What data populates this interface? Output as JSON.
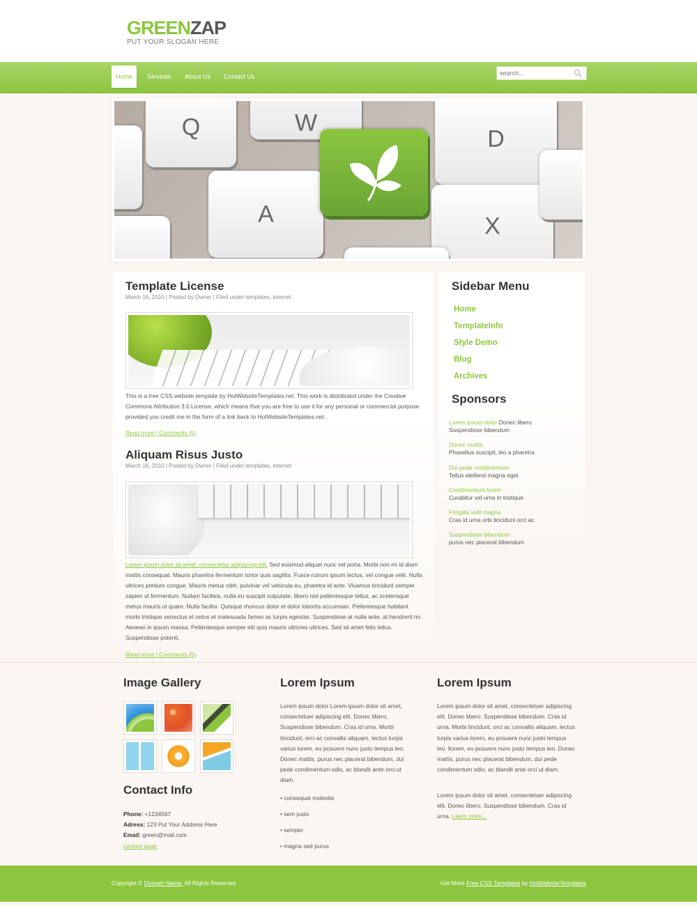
{
  "header": {
    "logo_green": "GREEN",
    "logo_gray": "ZAP",
    "slogan": "PUT YOUR SLOGAN HERE"
  },
  "nav": {
    "items": [
      "Home",
      "Services",
      "About Us",
      "Contact Us"
    ],
    "active": "Home"
  },
  "search": {
    "placeholder": "search..."
  },
  "hero": {
    "keys": [
      "Q",
      "W",
      "D",
      "A",
      "X"
    ]
  },
  "posts": [
    {
      "title": "Template License",
      "meta": "March 16, 2010 | Posted by Owner | Filed under templates, internet",
      "body": "This is a free CSS website template by HotWebsiteTemplates.net. This work is distributed under the Creative Commons Attribution 3.0 License, which means that you are free to use it for any personal or commercial purpose provided you credit me in the form of a link back to HotWebsiteTemplates.net.",
      "read_more": "Read more | Comments (5)"
    },
    {
      "title": "Aliquam Risus Justo",
      "meta": "March 16, 2010 | Posted by Owner | Filed under templates, internet",
      "link_text": "Lorem ipsum dolor sit amet, consectetur adipiscing elit.",
      "body": " Sed euismod aliquet nunc vel porta. Morbi non mi id diam mattis consequat. Mauris pharetra fermentum tortor quis sagittis. Fusce rutrum ipsum lectus, vel congue velit. Nulla ultrices pretium congue. Mauris metus nibh, pulvinar vel vehicula eu, pharetra id ante. Vivamus tincidunt semper sapien ut fermentum. Nullam facilisis, nulla eu suscipit vulputate, libero nisl pellentesque tellus, ac scelerisque metus mauris ut quam. Nulla facilisi. Quisque rhoncus dolor et dolor lobortis accumsan. Pellentesque habitant morbi tristique senectus et netus et malesuada fames ac turpis egestas. Suspendisse at nulla ante, at hendrerit mi. Aenean in ipsum massa. Pellentesque semper elit quis mauris ultricies ultrices. Sed sit amet felis tellus. Suspendisse potenti.",
      "read_more": "Read more | Comments (5)"
    }
  ],
  "sidebar": {
    "menu_title": "Sidebar Menu",
    "menu": [
      "Home",
      "TemplateInfo",
      "Style Demo",
      "Blog",
      "Archives"
    ],
    "sponsors_title": "Sponsors",
    "sponsors": [
      {
        "link": "Lorem ipsum dolor",
        "after": " Donec libero.",
        "line2": "Suspendisse bibendum"
      },
      {
        "link": "Donec mattis",
        "after": "",
        "line2": "Phasellus suscipit, leo a pharetra"
      },
      {
        "link": "Dui pede condimentum",
        "after": "",
        "line2": "Tellus eleifend magna eget"
      },
      {
        "link": "Condimentum lorem",
        "after": "",
        "line2": "Curabitur vel urna in tristique"
      },
      {
        "link": "Fringilla velit magna",
        "after": "",
        "line2": "Cras id urna orbi tincidunt orci ac"
      },
      {
        "link": "Suspendisse bibendum",
        "after": "",
        "line2": "purus nec placerat bibendum"
      }
    ]
  },
  "footer": {
    "gallery_title": "Image Gallery",
    "contact_title": "Contact Info",
    "contact": {
      "phone_label": "Phone:",
      "phone": " +1234567",
      "address_label": "Adress:",
      "address": " 123 Put Your Address Here",
      "email_label": "Email:",
      "email": " green@mail.com",
      "link": "contact page"
    },
    "col2": {
      "title": "Lorem Ipsum",
      "text": "Lorem ipsum dolor Lorem ipsum dolor sit amet, consectetuer adipiscing elit. Donec libero. Suspendisse bibendum. Cras id urna. Morbi tincidunt, orci ac convallis aliquam, lectus turpis varius lorem, eu posuere nunc justo tempus leo. Donec mattis, purus nec placerat bibendum, dui pede condimentum odio, ac blandit ante orci ut diam.",
      "bullets": [
        "• consequat molestie",
        "• sem justo",
        "• semper",
        "• magna sed purus"
      ]
    },
    "col3": {
      "title": "Lorem Ipsum",
      "text1": "Lorem ipsum dolor sit amet, consectetuer adipiscing elit. Donec libero. Suspendisse bibendum. Cras id urna. Morbi tincidunt, orci ac convallis aliquam, lectus turpis varius lorem, eu posuere nunc justo tempus leo. llorem, eu posuere nunc justo tempus leo. Donec mattis, purus nec placerat bibendum, dui pede condimentum odio, ac blandit ante orci ut diam.",
      "text2": "Lorem ipsum dolor sit amet, consectetuer adipiscing elit. Donec libero. Suspendisse bibendum. Cras id urna. ",
      "learn_more": "Learn more..."
    }
  },
  "bottom": {
    "copy_pre": "Copyright © ",
    "domain": "Domain Name.",
    "copy_post": " All Rights Reserved",
    "more_pre": "Get More ",
    "more_link1": "Free CSS Templates",
    "more_mid": " by ",
    "more_link2": "HotWebsiteTemplates"
  },
  "colors": {
    "accent": "#8cc63f",
    "background": "#fbf6f1",
    "heading": "#333333"
  }
}
